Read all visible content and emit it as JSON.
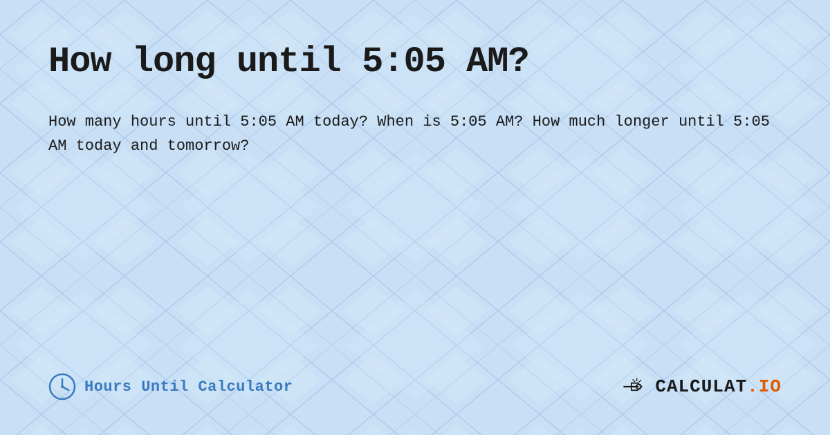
{
  "page": {
    "title": "How long until 5:05 AM?",
    "description": "How many hours until 5:05 AM today? When is 5:05 AM? How much longer until 5:05 AM today and tomorrow?",
    "background_color": "#c8dff5"
  },
  "footer": {
    "brand_label": "Hours Until Calculator",
    "logo_text": "CALCULAT.IO"
  }
}
